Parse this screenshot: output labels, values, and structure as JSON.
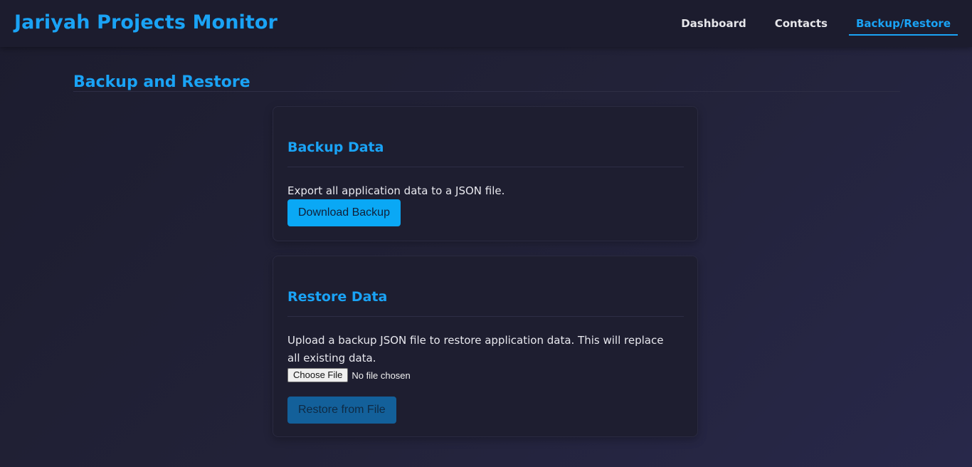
{
  "header": {
    "app_title": "Jariyah Projects Monitor",
    "nav": [
      {
        "label": "Dashboard",
        "active": false
      },
      {
        "label": "Contacts",
        "active": false
      },
      {
        "label": "Backup/Restore",
        "active": true
      }
    ]
  },
  "page": {
    "title": "Backup and Restore"
  },
  "backup": {
    "heading": "Backup Data",
    "description": "Export all application data to a JSON file.",
    "button_label": "Download Backup"
  },
  "restore": {
    "heading": "Restore Data",
    "description": "Upload a backup JSON file to restore application data. This will replace all existing data.",
    "choose_file_label": "Choose File",
    "file_status": "No file chosen",
    "button_label": "Restore from File",
    "button_disabled": true
  },
  "colors": {
    "accent": "#1aa3f5",
    "background": "#1c1c2e",
    "card": "#1e1e30"
  }
}
